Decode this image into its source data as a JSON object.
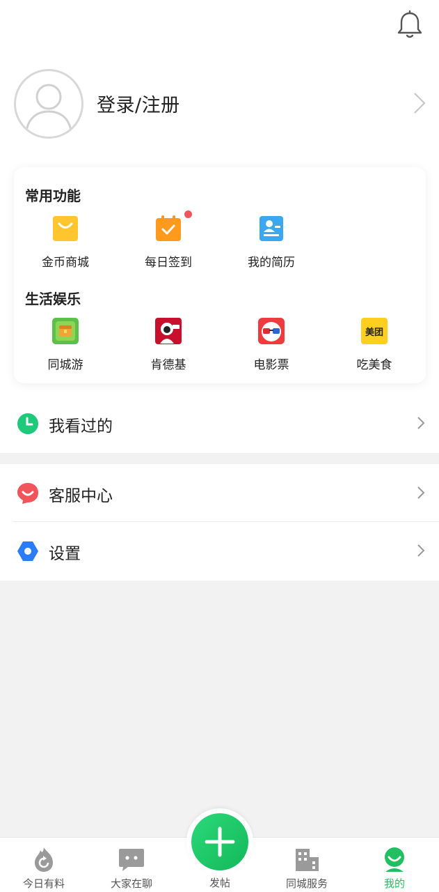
{
  "header": {
    "bell_icon": "bell-icon"
  },
  "profile": {
    "login_label": "登录/注册",
    "avatar_icon": "user-avatar-icon",
    "chevron_icon": "chevron-right-icon"
  },
  "common": {
    "title": "常用功能",
    "items": [
      {
        "label": "金币商城",
        "icon": "shopping-bag-icon",
        "color": "#ffc52e"
      },
      {
        "label": "每日签到",
        "icon": "calendar-check-icon",
        "color": "#ff9a1f",
        "badge": true
      },
      {
        "label": "我的简历",
        "icon": "resume-icon",
        "color": "#3aa7f0"
      }
    ]
  },
  "life": {
    "title": "生活娱乐",
    "items": [
      {
        "label": "同城游",
        "icon": "travel-game-icon",
        "color": "#5cc149"
      },
      {
        "label": "肯德基",
        "icon": "kfc-icon",
        "color": "#c8102e"
      },
      {
        "label": "电影票",
        "icon": "movie-glasses-icon",
        "color": "#ee3b40"
      },
      {
        "label": "吃美食",
        "icon": "meituan-icon",
        "color": "#ffcf1f",
        "logo_text": "美团"
      }
    ]
  },
  "menu": [
    {
      "label": "我看过的",
      "icon": "clock-icon",
      "color": "#1fc97a"
    },
    {
      "label": "客服中心",
      "icon": "customer-service-icon",
      "color": "#f2545b"
    },
    {
      "label": "设置",
      "icon": "settings-hexagon-icon",
      "color": "#2b7cf6"
    }
  ],
  "tabbar": {
    "tabs": [
      {
        "label": "今日有料",
        "icon": "flame-refresh-icon"
      },
      {
        "label": "大家在聊",
        "icon": "chat-bubble-icon"
      },
      {
        "label": "发帖",
        "icon": "plus-icon"
      },
      {
        "label": "同城服务",
        "icon": "building-icon"
      },
      {
        "label": "我的",
        "icon": "profile-icon",
        "active": true
      }
    ],
    "active_color": "#20c062"
  }
}
